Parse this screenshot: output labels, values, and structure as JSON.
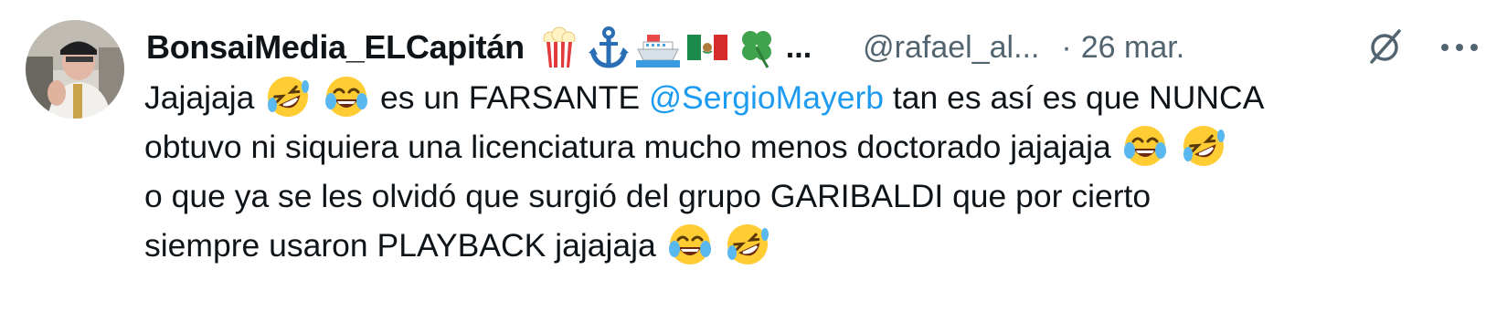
{
  "tweet": {
    "author_name": "BonsaiMedia_ELCapitán",
    "name_badges": [
      "popcorn-emoji",
      "anchor-emoji",
      "ship-emoji",
      "mexico-flag-emoji",
      "four-leaf-clover-emoji"
    ],
    "name_ellipsis": "...",
    "handle": "@rafael_al...",
    "separator": "·",
    "date": "26 mar.",
    "body": {
      "line1_a": "Jajajaja",
      "line1_b": "es un FARSANTE",
      "mention": "@SergioMayerb",
      "line1_c": "tan es así es que NUNCA",
      "line2": "obtuvo ni siquiera una licenciatura mucho menos doctorado jajajaja",
      "line3": "o que ya se les olvidó que surgió del grupo GARIBALDI que por cierto",
      "line4": "siempre usaron PLAYBACK jajajaja"
    },
    "icons": {
      "grok": "grok-slash-icon",
      "more": "more-dots-icon"
    },
    "colors": {
      "text": "#0f1419",
      "secondary": "#536471",
      "mention": "#1d9bf0"
    }
  }
}
